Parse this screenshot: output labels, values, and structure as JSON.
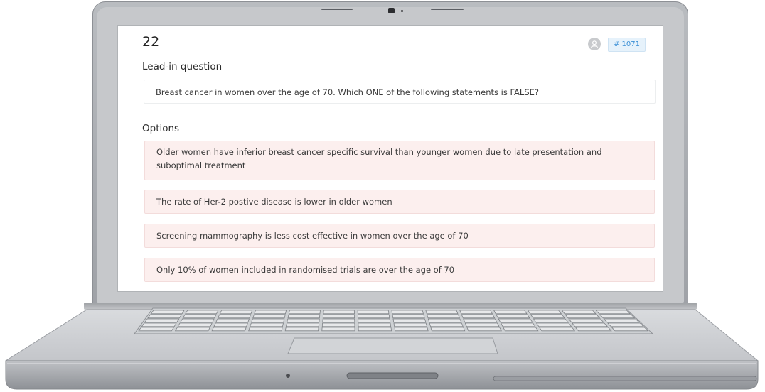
{
  "question": {
    "number": "22",
    "id_badge": "# 1071",
    "lead_in_title": "Lead-in question",
    "lead_in_text": "Breast cancer in women over the age of 70. Which ONE of the following statements is FALSE?",
    "options_title": "Options",
    "options": [
      {
        "text": "Older women have inferior breast cancer specific survival than younger women due to late presentation and suboptimal treatment"
      },
      {
        "text": "The rate of Her-2 postive disease is lower in older women"
      },
      {
        "text": "Screening mammography is less cost effective in women over the age of 70"
      },
      {
        "text": "Only 10% of women included in randomised trials are over the age of 70"
      }
    ]
  },
  "icons": {
    "avatar": "user-icon",
    "webcam": "webcam-icon"
  },
  "colors": {
    "option_bg": "#fcefee",
    "option_border": "#f3dcdb",
    "badge_bg": "#e6f2fb",
    "badge_text": "#3a8fd6",
    "laptop_body": "#b9bcc0"
  }
}
